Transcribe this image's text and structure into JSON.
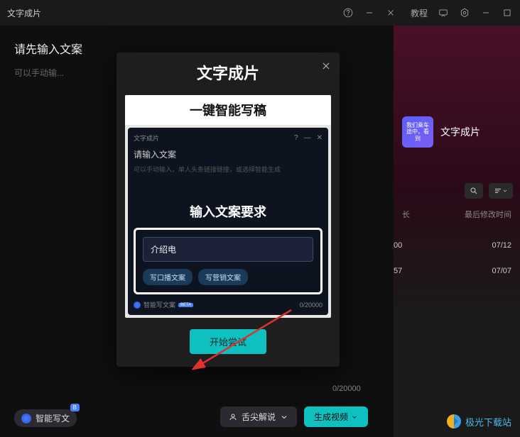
{
  "header": {
    "title": "文字成片",
    "tutorial": "教程"
  },
  "main": {
    "prompt": "请先输入文案",
    "placeholder": "可以手动输..."
  },
  "modal": {
    "title": "文字成片",
    "demo": {
      "heading1": "一键智能写稿",
      "window_title": "文字成片",
      "label": "请输入文案",
      "placeholder": "可以手动输入，单人头条链接链接，或选择智能生成",
      "heading2": "输入文案要求",
      "input_value": "介绍电",
      "chip1": "写口播文案",
      "chip2": "写营销文案",
      "ai_label": "智能写文案",
      "badge": "BETA",
      "counter": "0/20000"
    },
    "start_button": "开始尝试"
  },
  "bottom": {
    "ai_label": "智能写文",
    "badge": "B",
    "counter": "0/20000",
    "voice_select": "舌尖解说",
    "generate": "生成视频"
  },
  "right": {
    "thumb_text": "我们乘车途中，看到",
    "card_label": "文字成片",
    "col1": "长",
    "col2": "最后修改时间",
    "time1": "00",
    "time2": "57",
    "date1": "07/12",
    "date2": "07/07"
  },
  "logo": "极光下载站"
}
